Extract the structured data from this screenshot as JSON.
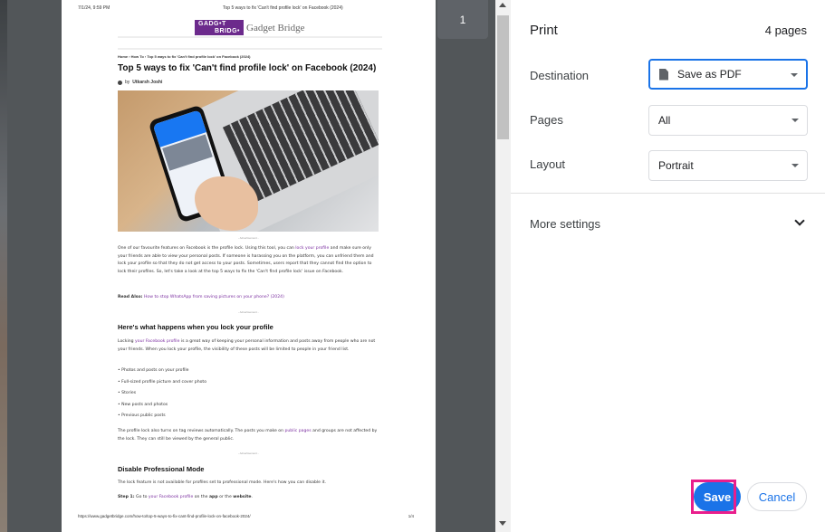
{
  "preview": {
    "header": {
      "date": "7/1/24, 9:59 PM",
      "page_title": "Top 5 ways to fix 'Can't find profile lock' on Facebook (2024)"
    },
    "logo": {
      "mark_line1": "GADG•T",
      "mark_line2": "BRIDG•",
      "text": "Gadget Bridge"
    },
    "breadcrumb": "Home › How To › Top 5 ways to fix 'Can't find profile lock' on Facebook (2024)",
    "article_title": "Top 5 ways to fix 'Can't find profile lock' on Facebook (2024)",
    "byline_prefix": "by",
    "author": "Utkarsh Joshi",
    "ad_label": "- Advertisement -",
    "intro_before": "One of our favourite features on Facebook is the profile lock. Using this tool, you can ",
    "intro_link": "lock your profile",
    "intro_after": " and make sure only your friends are able to view your personal posts. If someone is harassing you on the platform, you can unfriend them and lock your profile so that they do not get access to your posts. Sometimes, users report that they cannot find the option to lock their profiles. So, let's take a look at the top 5 ways to fix the 'Can't find profile lock' issue on Facebook.",
    "read_also_label": "Read Also:",
    "read_also_link": "How to stop WhatsApp from saving pictures on your phone? (2024)",
    "section1_title": "Here's what happens when you lock your profile",
    "section1_before": "Locking ",
    "section1_link": "your Facebook profile",
    "section1_after": " is a great way of keeping your personal information and posts away from people who are not your friends. When you lock your profile, the visibility of these posts will be limited to people in your friend list.",
    "bullets": [
      "Photos and posts on your profile",
      "Full-sized profile picture and cover photo",
      "Stories",
      "New posts and photos",
      "Previous public posts"
    ],
    "tag_before": "The profile lock also turns on tag reviews automatically. The posts you make on ",
    "tag_link": "public pages",
    "tag_after": " and groups are not affected by the lock. They can still be viewed by the general public.",
    "section2_title": "Disable Professional Mode",
    "section2_text": "The lock feature is not available for profiles set to professional mode. Here's how you can disable it.",
    "step1_label": "Step 1:",
    "step1_before": " Go to ",
    "step1_link": "your Facebook profile",
    "step1_mid": " on the ",
    "step1_app": "app",
    "step1_or": " or the ",
    "step1_web": "website",
    "step1_end": ".",
    "footer_url": "https://www.gadgetbridge.com/how-to/top-5-ways-to-fix-cant-find-profile-lock-on-facebook-2024/",
    "footer_page": "1/4",
    "page_badge": "1"
  },
  "panel": {
    "title": "Print",
    "page_count": "4 pages",
    "destination_label": "Destination",
    "destination_value": "Save as PDF",
    "pages_label": "Pages",
    "pages_value": "All",
    "layout_label": "Layout",
    "layout_value": "Portrait",
    "more_settings_label": "More settings",
    "save_label": "Save",
    "cancel_label": "Cancel"
  },
  "colors": {
    "accent": "#1a73e8",
    "highlight": "#e91e8c",
    "link": "#7b2fa0",
    "logo": "#6c2a8c"
  },
  "icons": [
    "pdf-file-icon",
    "dropdown-caret-icon",
    "chevron-down-icon",
    "scroll-up-arrow-icon",
    "scroll-down-arrow-icon",
    "page-up-icon",
    "author-avatar-icon"
  ]
}
